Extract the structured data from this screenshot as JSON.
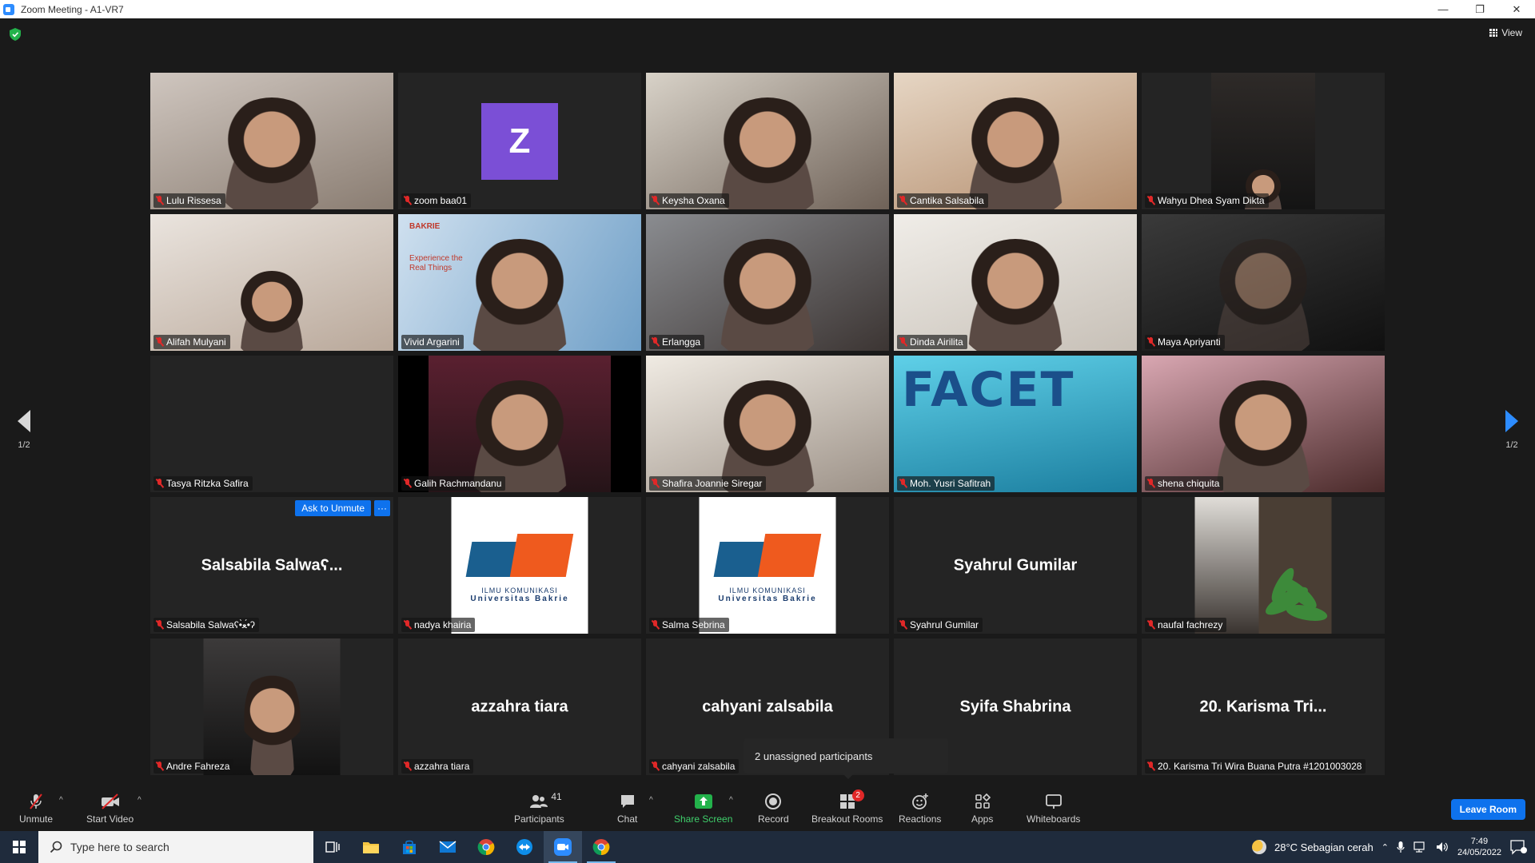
{
  "window": {
    "title": "Zoom Meeting - A1-VR7",
    "minimize": "—",
    "restore": "❐",
    "close": "✕"
  },
  "top": {
    "view_label": "View"
  },
  "pager": {
    "left_label": "1/2",
    "right_label": "1/2"
  },
  "tiles": [
    {
      "name": "Lulu Rissesa",
      "muted": true
    },
    {
      "name": "zoom baa01",
      "muted": true,
      "avatar_letter": "Z"
    },
    {
      "name": "Keysha Oxana",
      "muted": true
    },
    {
      "name": "Cantika Salsabila",
      "muted": true
    },
    {
      "name": "Wahyu Dhea Syam Dikta",
      "muted": true
    },
    {
      "name": "Alifah Mulyani",
      "muted": true
    },
    {
      "name": "Vivid Argarini",
      "muted": false,
      "active": true,
      "bg_brand": "BAKRIE",
      "bg_text": "Experience the Real Things"
    },
    {
      "name": "Erlangga",
      "muted": true
    },
    {
      "name": "Dinda Airilita",
      "muted": true
    },
    {
      "name": "Maya Apriyanti",
      "muted": true
    },
    {
      "name": "Tasya Ritzka Safira",
      "muted": true
    },
    {
      "name": "Galih Rachmandanu",
      "muted": true
    },
    {
      "name": "Shafira Joannie Siregar",
      "muted": true
    },
    {
      "name": "Moh. Yusri Safitrah",
      "muted": true,
      "bg_text": "FACET"
    },
    {
      "name": "shena chiquita",
      "muted": true
    },
    {
      "name": "Salsabila Salwaʕ•̀ﻌ•́ʔ",
      "muted": true,
      "display_name": "Salsabila Salwaʕ...",
      "ask_unmute": "Ask to Unmute",
      "more": "···"
    },
    {
      "name": "nadya khairia",
      "muted": true,
      "logo_line1": "ILMU KOMUNIKASI",
      "logo_line2": "Universitas Bakrie"
    },
    {
      "name": "Salma Sebrina",
      "muted": true,
      "logo_line1": "ILMU KOMUNIKASI",
      "logo_line2": "Universitas Bakrie"
    },
    {
      "name": "Syahrul Gumilar",
      "muted": true,
      "display_name": "Syahrul Gumilar"
    },
    {
      "name": "naufal fachrezy",
      "muted": true
    },
    {
      "name": "Andre Fahreza",
      "muted": true
    },
    {
      "name": "azzahra tiara",
      "muted": true,
      "display_name": "azzahra tiara"
    },
    {
      "name": "cahyani zalsabila",
      "muted": true,
      "display_name": "cahyani zalsabila"
    },
    {
      "name": "abrina",
      "muted": true,
      "display_name": "Syifa Shabrina"
    },
    {
      "name": "20. Karisma Tri Wira Buana Putra #1201003028",
      "muted": true,
      "display_name": "20. Karisma Tri..."
    }
  ],
  "tooltip": {
    "text": "2 unassigned participants"
  },
  "toolbar": {
    "unmute": "Unmute",
    "start_video": "Start Video",
    "participants": "Participants",
    "participants_count": "41",
    "chat": "Chat",
    "share_screen": "Share Screen",
    "record": "Record",
    "breakout_rooms": "Breakout Rooms",
    "breakout_badge": "2",
    "reactions": "Reactions",
    "apps": "Apps",
    "whiteboards": "Whiteboards",
    "leave": "Leave Room"
  },
  "taskbar": {
    "search_placeholder": "Type here to search",
    "weather": "28°C  Sebagian cerah",
    "time": "7:49",
    "date": "24/05/2022"
  },
  "colors": {
    "accent": "#0e72ed",
    "share_green": "#3fcf6b",
    "muted_red": "#e02828",
    "active_speaker": "#e8f07a",
    "avatar_purple": "#7b4fd6"
  }
}
